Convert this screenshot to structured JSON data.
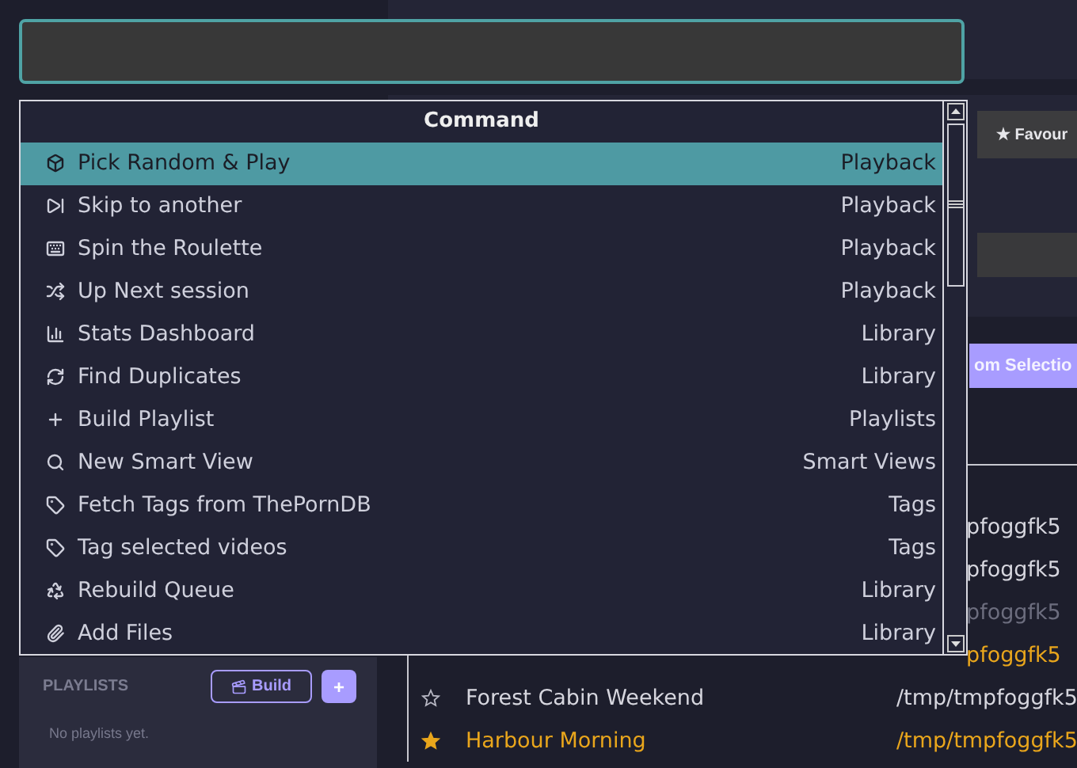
{
  "palette": {
    "header": "Command",
    "commands": [
      {
        "kind": "box",
        "label": "Pick Random & Play",
        "category": "Playback",
        "selected": true
      },
      {
        "kind": "skip",
        "label": "Skip to another",
        "category": "Playback",
        "selected": false
      },
      {
        "kind": "keyboard",
        "label": "Spin the Roulette",
        "category": "Playback",
        "selected": false
      },
      {
        "kind": "shuffle",
        "label": "Up Next session",
        "category": "Playback",
        "selected": false
      },
      {
        "kind": "chart",
        "label": "Stats Dashboard",
        "category": "Library",
        "selected": false
      },
      {
        "kind": "refresh",
        "label": "Find Duplicates",
        "category": "Library",
        "selected": false
      },
      {
        "kind": "plus",
        "label": "Build Playlist",
        "category": "Playlists",
        "selected": false
      },
      {
        "kind": "search",
        "label": "New Smart View",
        "category": "Smart Views",
        "selected": false
      },
      {
        "kind": "tag",
        "label": "Fetch Tags from ThePornDB",
        "category": "Tags",
        "selected": false
      },
      {
        "kind": "tag",
        "label": "Tag selected videos",
        "category": "Tags",
        "selected": false
      },
      {
        "kind": "recycle",
        "label": "Rebuild Queue",
        "category": "Library",
        "selected": false
      },
      {
        "kind": "clip",
        "label": "Add Files",
        "category": "Library",
        "selected": false
      }
    ]
  },
  "toolbar": {
    "favourites_button": "★ Favour",
    "selection_button": "om Selectio"
  },
  "sidebar": {
    "playlists": {
      "title": "PLAYLISTS",
      "build_button": "Build",
      "add_button": "+",
      "empty_text": "No playlists yet."
    }
  },
  "videos": [
    {
      "path": "pfoggfk5",
      "favourite": false,
      "dimmed": false
    },
    {
      "path": "pfoggfk5",
      "favourite": false,
      "dimmed": false
    },
    {
      "path": "pfoggfk5",
      "favourite": false,
      "dimmed": true
    },
    {
      "path": "pfoggfk5",
      "favourite": true,
      "dimmed": false
    },
    {
      "title": "Forest Cabin Weekend",
      "path": "/tmp/tmpfoggfk5",
      "favourite": false,
      "dimmed": false
    },
    {
      "title": "Harbour Morning",
      "path": "/tmp/tmpfoggfk5",
      "favourite": true,
      "dimmed": false
    }
  ]
}
